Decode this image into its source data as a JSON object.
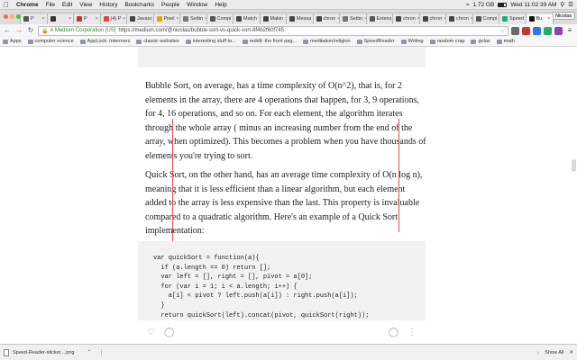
{
  "menubar": {
    "items": [
      "Chrome",
      "File",
      "Edit",
      "View",
      "History",
      "Bookmarks",
      "People",
      "Window",
      "Help"
    ],
    "battery": "1.72 GB",
    "clock": "Wed 11:02:39 AM"
  },
  "tabs": [
    {
      "label": "P",
      "color": "#555"
    },
    {
      "label": "",
      "color": "#333"
    },
    {
      "label": "P",
      "color": "#c33"
    },
    {
      "label": "(4) P",
      "color": "#d44"
    },
    {
      "label": "Javasc",
      "color": "#444"
    },
    {
      "label": "Pixel",
      "color": "#e8a400"
    },
    {
      "label": "Settin",
      "color": "#777"
    },
    {
      "label": "Compi",
      "color": "#555"
    },
    {
      "label": "Match",
      "color": "#444"
    },
    {
      "label": "Makin",
      "color": "#444"
    },
    {
      "label": "Messa",
      "color": "#444"
    },
    {
      "label": "chron",
      "color": "#444"
    },
    {
      "label": "Settin",
      "color": "#777"
    },
    {
      "label": "Extens",
      "color": "#555"
    },
    {
      "label": "chron",
      "color": "#444"
    },
    {
      "label": "chron",
      "color": "#444"
    },
    {
      "label": "chron",
      "color": "#444"
    },
    {
      "label": "Compi",
      "color": "#555"
    },
    {
      "label": "Speed",
      "color": "#2a7"
    },
    {
      "label": "Bu",
      "color": "#111",
      "active": true
    }
  ],
  "profile": "Nicolas",
  "omnibox": {
    "org": "A Medium Corporation [US]",
    "url": "https://medium.com/@nicolas/bubble-sort-vs-quick-sort-8f4b2f60f745"
  },
  "bookmarks": [
    {
      "label": "Apps"
    },
    {
      "label": "computer science"
    },
    {
      "label": "AppLock: Intermerz"
    },
    {
      "label": "classic websites"
    },
    {
      "label": "interesting stuff to..."
    },
    {
      "label": "reddit: the front pag..."
    },
    {
      "label": "meditation/religion"
    },
    {
      "label": "SpeedReader"
    },
    {
      "label": "Writing"
    },
    {
      "label": "random crap"
    },
    {
      "label": "golas"
    },
    {
      "label": "math"
    }
  ],
  "article": {
    "para1": "Bubble Sort, on average, has a time complexity of O(n^2), that is, for 2 elements in the array, there are 4 operations that happen, for 3, 9 operations, for 4, 16 operations, and so on. For each element, the algorithm iterates through the whole array ( minus an increasing number from the end of the array, when optimized). This becomes a problem when you have thousands of elements you're trying to sort.",
    "para2": "Quick Sort, on the other hand, has an average time complexity of O(n log n), meaning that it is less efficient than a linear algorithm, but each element added to the array is less expensive than the last. This property is invaluable compared to a quadratic algorithm. Here's an example of a Quick Sort implementation:",
    "code": "var quickSort = function(a){\n  if (a.length == 0) return [];\n  var left = [], right = [], pivot = a[0];\n  for (var i = 1; i < a.length; i++) {\n    a[i] < pivot ? left.push(a[i]) : right.push(a[i]);\n  }\n  return quickSort(left).concat(pivot, quickSort(right));"
  },
  "downloads": {
    "filename": "Speed-Reader-sticker....png",
    "show_all": "Show All"
  }
}
